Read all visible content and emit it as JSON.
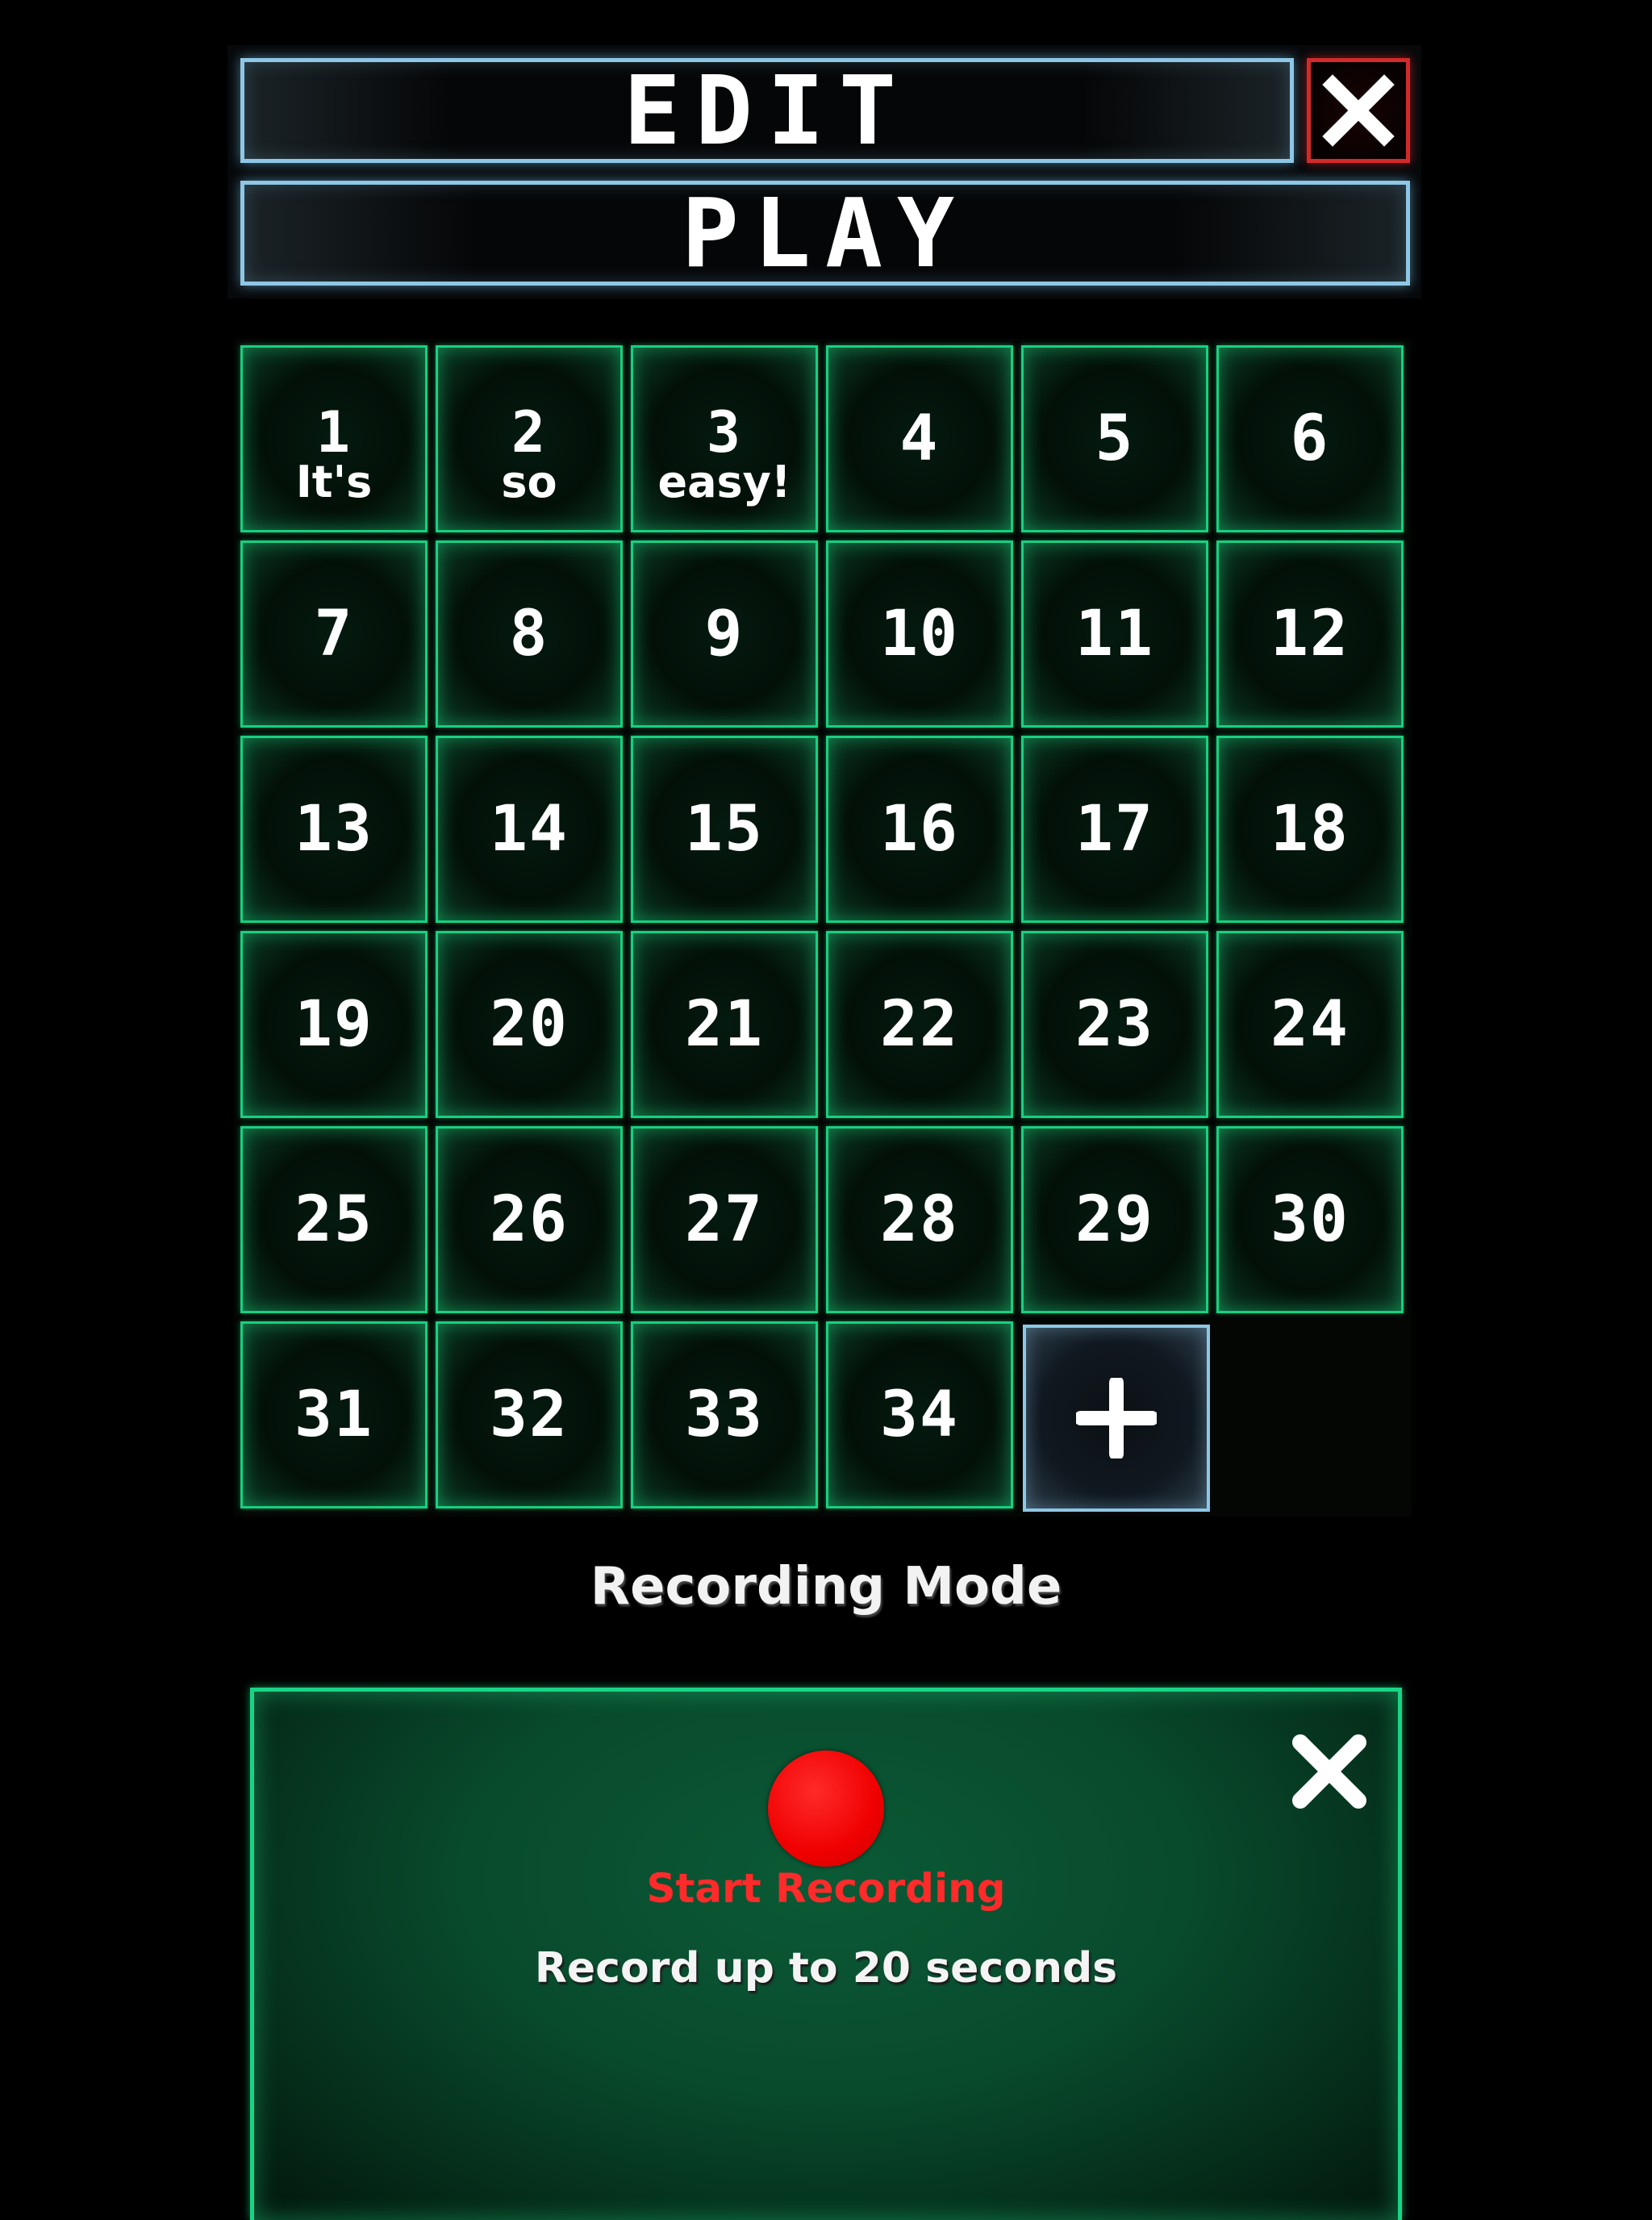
{
  "header": {
    "edit_label": "EDIT",
    "play_label": "PLAY",
    "close_icon": "close-icon"
  },
  "grid": {
    "cells": [
      {
        "num": "1",
        "label": "It's"
      },
      {
        "num": "2",
        "label": "so"
      },
      {
        "num": "3",
        "label": "easy!"
      },
      {
        "num": "4",
        "label": ""
      },
      {
        "num": "5",
        "label": ""
      },
      {
        "num": "6",
        "label": ""
      },
      {
        "num": "7",
        "label": ""
      },
      {
        "num": "8",
        "label": ""
      },
      {
        "num": "9",
        "label": ""
      },
      {
        "num": "10",
        "label": ""
      },
      {
        "num": "11",
        "label": ""
      },
      {
        "num": "12",
        "label": ""
      },
      {
        "num": "13",
        "label": ""
      },
      {
        "num": "14",
        "label": ""
      },
      {
        "num": "15",
        "label": ""
      },
      {
        "num": "16",
        "label": ""
      },
      {
        "num": "17",
        "label": ""
      },
      {
        "num": "18",
        "label": ""
      },
      {
        "num": "19",
        "label": ""
      },
      {
        "num": "20",
        "label": ""
      },
      {
        "num": "21",
        "label": ""
      },
      {
        "num": "22",
        "label": ""
      },
      {
        "num": "23",
        "label": ""
      },
      {
        "num": "24",
        "label": ""
      },
      {
        "num": "25",
        "label": ""
      },
      {
        "num": "26",
        "label": ""
      },
      {
        "num": "27",
        "label": ""
      },
      {
        "num": "28",
        "label": ""
      },
      {
        "num": "29",
        "label": ""
      },
      {
        "num": "30",
        "label": ""
      },
      {
        "num": "31",
        "label": ""
      },
      {
        "num": "32",
        "label": ""
      },
      {
        "num": "33",
        "label": ""
      },
      {
        "num": "34",
        "label": ""
      }
    ],
    "add_icon": "plus-icon"
  },
  "mode": {
    "title": "Recording Mode"
  },
  "recording": {
    "start_label": "Start Recording",
    "info": "Record up to 20 seconds",
    "close_icon": "close-icon",
    "record_icon": "record-dot-icon"
  },
  "colors": {
    "cell_border": "#17d080",
    "bar_border": "#8ec7e6",
    "close_border": "#d22a2a",
    "record_red": "#ff2a2a",
    "panel_green": "#0b5a36"
  }
}
